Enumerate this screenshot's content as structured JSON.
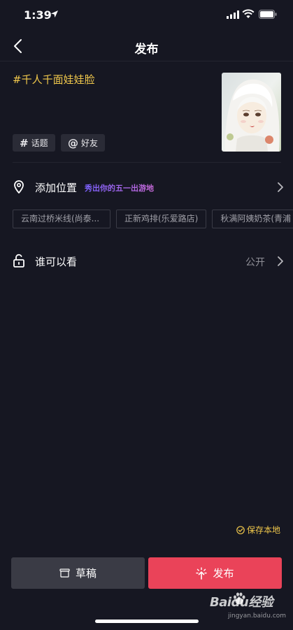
{
  "status_bar": {
    "time": "1:39"
  },
  "nav": {
    "title": "发布"
  },
  "post": {
    "caption": "#千人千面娃娃脸"
  },
  "chips": {
    "topic": {
      "symbol": "#",
      "label": "话题"
    },
    "friend": {
      "symbol": "@",
      "label": "好友"
    }
  },
  "location": {
    "label": "添加位置",
    "promo": "秀出你的五一出游地"
  },
  "poi_suggestions": [
    "云南过桥米线(尚泰...",
    "正新鸡排(乐爱路店)",
    "秋满阿姨奶茶(青浦"
  ],
  "visibility": {
    "label": "谁可以看",
    "value": "公开"
  },
  "save_local": {
    "label": "保存本地"
  },
  "actions": {
    "draft": "草稿",
    "publish": "发布"
  },
  "watermark": {
    "brand": "Baidu经验",
    "url": "jingyan.baidu.com"
  },
  "colors": {
    "background": "#161722",
    "accent_yellow": "#f2c94c",
    "publish_red": "#ea4359",
    "draft_gray": "#3a3b45"
  }
}
